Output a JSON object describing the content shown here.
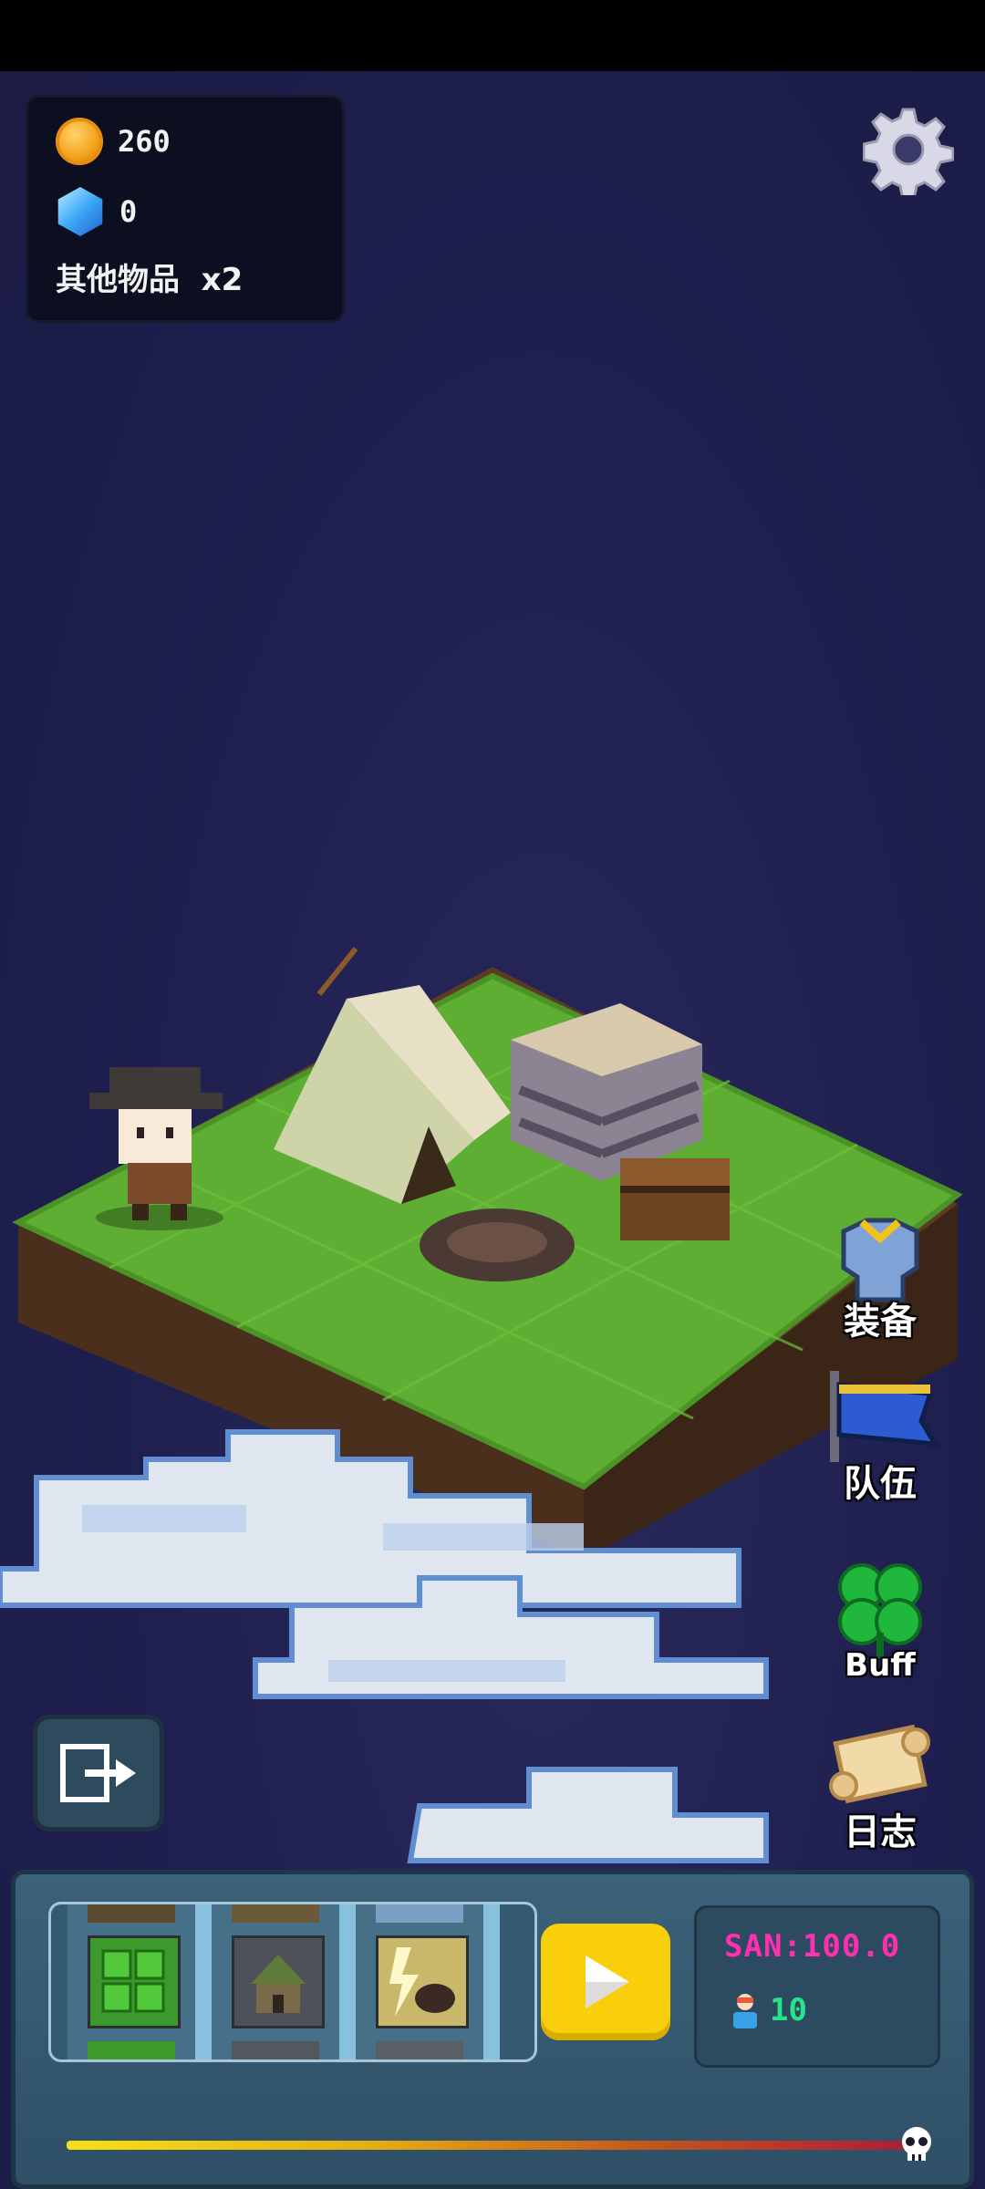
{
  "resources": {
    "coins": "260",
    "gems": "0",
    "other_items": "其他物品  x2"
  },
  "side_menu": {
    "equipment": "装备",
    "team": "队伍",
    "buff": "Buff",
    "log": "日志"
  },
  "bottom_bar": {
    "san": "SAN:100.0",
    "population": "10",
    "slots": [
      "green-field-tile",
      "hut-tile",
      "lightning-monster-tile"
    ]
  },
  "icons": {
    "coin": "coin-icon",
    "gem": "gem-icon",
    "settings": "gear-icon",
    "exit": "exit-icon",
    "play": "play-icon",
    "person": "person-icon",
    "skull": "skull-icon"
  },
  "colors": {
    "background": "#1e1e4d",
    "san_text": "#ff2fb0",
    "population_text": "#27e38a",
    "play_button": "#f8cf0a"
  }
}
